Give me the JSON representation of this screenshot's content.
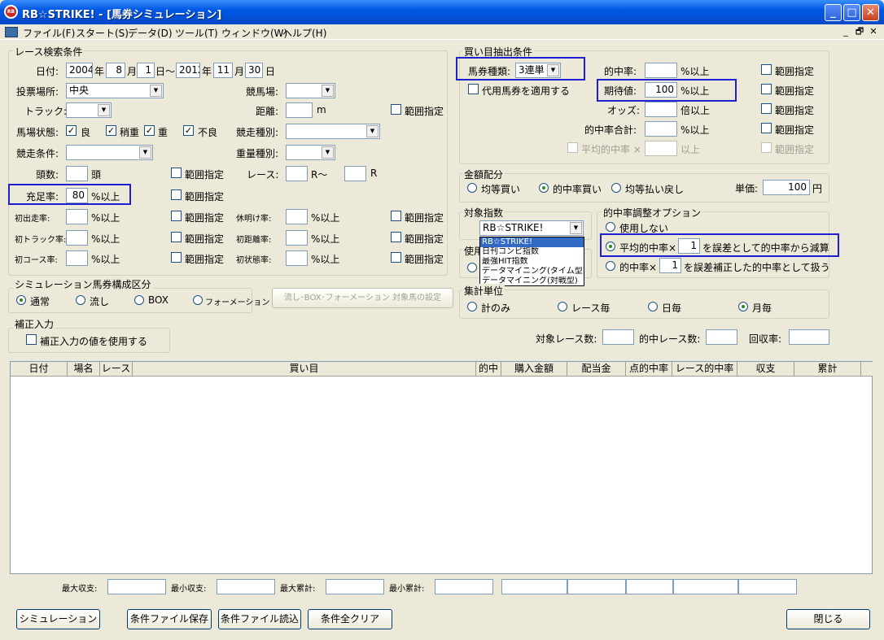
{
  "window": {
    "title": "RB☆STRIKE! - [馬券シミュレーション]",
    "icon": "app-logo-icon",
    "minimize": "_",
    "maximize": "□",
    "close": "✕"
  },
  "menu": [
    "ファイル(F)",
    "スタート(S)",
    "データ(D)",
    "ツール(T)",
    "ウィンドウ(W)",
    "ヘルプ(H)"
  ],
  "mdi_controls": [
    "_",
    "🗗",
    "✕"
  ],
  "race_search": {
    "legend": "レース検索条件",
    "date_label": "日付:",
    "start_year": "2004",
    "year_unit": "年",
    "start_month": "8",
    "month_unit": "月",
    "start_day": "1",
    "day_range": "日〜",
    "end_year": "2012",
    "end_month": "11",
    "end_day": "30",
    "day_unit": "日",
    "venue_label": "投票場所:",
    "venue_value": "中央",
    "track_place_label": "競馬場:",
    "track_label": "トラック:",
    "distance_label": "距離:",
    "distance_unit": "m",
    "range_label": "範囲指定",
    "condition_label": "馬場状態:",
    "cond_good": "良",
    "cond_slightly": "稍重",
    "cond_heavy": "重",
    "cond_bad": "不良",
    "race_type_label": "競走種別:",
    "race_cond_label": "競走条件:",
    "weight_type_label": "重量種別:",
    "heads_label": "頭数:",
    "heads_unit": "頭",
    "race_label": "レース:",
    "race_r_from": "R〜",
    "race_r": "R",
    "fill_rate_label": "充足率:",
    "fill_rate_value": "80",
    "pct_over": "%以上",
    "first_run_label": "初出走率:",
    "rest_label": "休明け率:",
    "first_track_label": "初トラック率:",
    "first_dist_label": "初距離率:",
    "first_course_label": "初コース率:",
    "first_cond_label": "初状態率:"
  },
  "bet_cond": {
    "legend": "買い目抽出条件",
    "ticket_type_label": "馬券種類:",
    "ticket_type_value": "3連単",
    "substitute_label": "代用馬券を適用する",
    "hit_rate_label": "的中率:",
    "pct_over": "%以上",
    "expected_label": "期待値:",
    "expected_value": "100",
    "odds_label": "オッズ:",
    "odds_unit": "倍以上",
    "hit_total_label": "的中率合計:",
    "avg_hit_label": "平均的中率 ×",
    "above": "以上",
    "range_label": "範囲指定"
  },
  "allocation": {
    "legend": "金額配分",
    "opt1": "均等買い",
    "opt2": "的中率買い",
    "opt3": "均等払い戻し",
    "unit_label": "単価:",
    "unit_value": "100",
    "yen": "円"
  },
  "index": {
    "legend": "対象指数",
    "value": "RB☆STRIKE!",
    "options": [
      "RB☆STRIKE!",
      "日刊コンピ指数",
      "最強HIT指数",
      "データマイニング(タイム型)",
      "データマイニング(対戦型)"
    ]
  },
  "use": {
    "legend": "使用"
  },
  "hit_adjust": {
    "legend": "的中率調整オプション",
    "opt_none": "使用しない",
    "opt_avg_prefix": "平均的中率×",
    "opt_avg_value": "1",
    "opt_avg_suffix": "を誤差として的中率から減算",
    "opt_rate_prefix": "的中率×",
    "opt_rate_value": "1",
    "opt_rate_suffix": "を誤差補正した的中率として扱う"
  },
  "aggregate": {
    "legend": "集計単位",
    "opt1": "計のみ",
    "opt2": "レース毎",
    "opt3": "日毎",
    "opt4": "月毎"
  },
  "sim_type": {
    "legend": "シミュレーション馬券構成区分",
    "opt1": "通常",
    "opt2": "流し",
    "opt3": "BOX",
    "opt4": "フォーメーション"
  },
  "set_button": "流し･BOX･フォーメーション 対象馬の設定",
  "correction": {
    "legend": "補正入力",
    "label": "補正入力の値を使用する"
  },
  "stats": {
    "target_races": "対象レース数:",
    "hit_races": "的中レース数:",
    "recovery": "回収率:"
  },
  "table": {
    "headers": [
      "日付",
      "場名",
      "レース",
      "買い目",
      "的中",
      "購入金額",
      "配当金",
      "点的中率",
      "レース的中率",
      "収支",
      "累計"
    ]
  },
  "footer": {
    "max_balance": "最大収支:",
    "min_balance": "最小収支:",
    "max_cum": "最大累計:",
    "min_cum": "最小累計:"
  },
  "buttons": {
    "simulate": "シミュレーション",
    "save": "条件ファイル保存",
    "load": "条件ファイル読込",
    "clear": "条件全クリア",
    "close": "閉じる"
  }
}
